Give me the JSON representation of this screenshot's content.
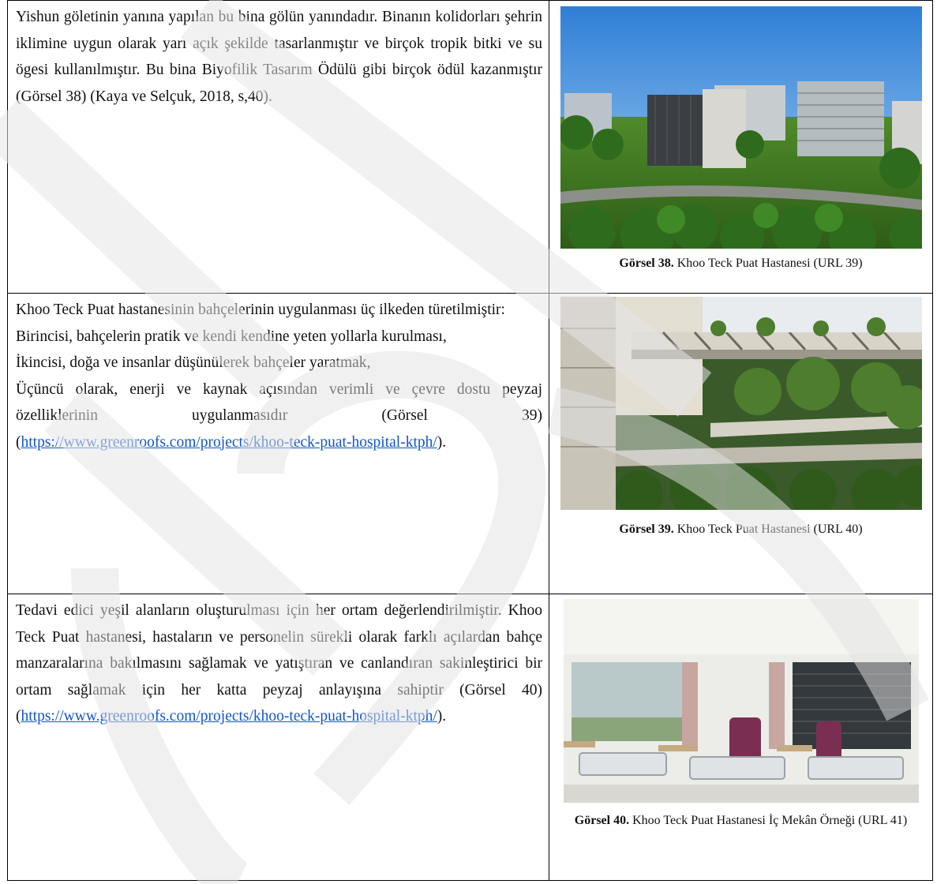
{
  "rows": [
    {
      "text": [
        "Yishun göletinin yanına yapılan bu bina gölün yanındadır. Binanın kolidorları şehrin iklimine uygun olarak yarı açık şekilde tasarlanmıştır ve birçok tropik bitki ve su ögesi kullanılmıştır. Bu bina Biyofilik Tasarım Ödülü gibi birçok ödül kazanmıştır (Görsel 38) (Kaya ve Selçuk, 2018, s,40)."
      ],
      "caption_bold": "Görsel 38.",
      "caption_text": " Khoo Teck Puat Hastanesi (URL 39)"
    },
    {
      "text": [
        "Khoo Teck Puat hastanesinin bahçelerinin uygulanması üç ilkeden türetilmiştir:",
        "Birincisi, bahçelerin pratik ve kendi kendine yeten yollarla kurulması,",
        "İkincisi, doğa ve insanlar düşünülerek bahçeler yaratmak,",
        "Üçüncü olarak, enerji ve kaynak açısından verimli ve çevre dostu peyzaj özelliklerinin uygulanmasıdır (Görsel 39)"
      ],
      "link": "https://www.greenroofs.com/projects/khoo-teck-puat-hospital-ktph/",
      "caption_bold": "Görsel 39.",
      "caption_text": " Khoo Teck Puat Hastanesi (URL 40)"
    },
    {
      "text": [
        "Tedavi edici yeşil alanların oluşturulması için her ortam değerlendirilmiştir. Khoo Teck Puat hastanesi, hastaların ve personelin sürekli olarak farklı açılardan bahçe manzaralarına bakılmasını sağlamak ve yatıştıran ve canlandıran sakinleştirici bir ortam sağlamak için her katta peyzaj anlayışına sahiptir (Görsel 40)"
      ],
      "link": "https://www.greenroofs.com/projects/khoo-teck-puat-hospital-ktph/",
      "caption_bold": "Görsel 40.",
      "caption_text": " Khoo Teck Puat Hastanesi İç Mekân Örneği (URL 41)"
    }
  ],
  "link_prefix": "(",
  "link_suffix": ")."
}
